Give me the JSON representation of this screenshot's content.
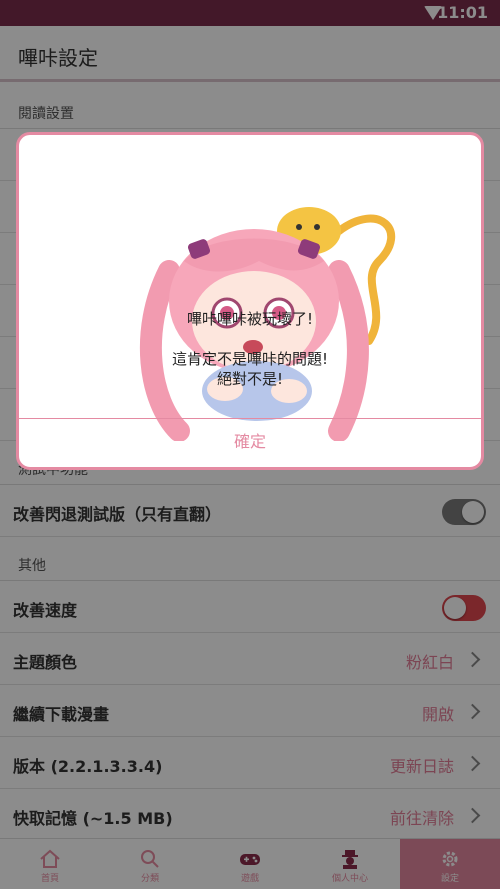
{
  "status": {
    "time": "11:01"
  },
  "appbar": {
    "title": "嗶咔設定"
  },
  "settings": {
    "section_reading": "閱讀設置",
    "section_test": "測試中功能",
    "test_item": "改善閃退測試版（只有直翻）",
    "section_other": "其他",
    "speed": "改善速度",
    "theme_label": "主題顏色",
    "theme_value": "粉紅白",
    "download_label": "繼續下載漫畫",
    "download_value": "開啟",
    "version_label": "版本 (2.2.1.3.3.4)",
    "version_value": "更新日誌",
    "cache_label": "快取記憶 (~1.5 MB)",
    "cache_value": "前往清除"
  },
  "tabs": [
    {
      "label": "首頁",
      "icon": "home-icon"
    },
    {
      "label": "分類",
      "icon": "search-icon"
    },
    {
      "label": "遊戲",
      "icon": "gamepad-icon"
    },
    {
      "label": "個人中心",
      "icon": "profile-icon"
    },
    {
      "label": "設定",
      "icon": "gear-icon"
    }
  ],
  "dialog": {
    "line1": "嗶咔嗶咔被玩壞了!",
    "line2": "這肯定不是嗶咔的問題!",
    "line3": "絕對不是!",
    "confirm": "確定"
  },
  "colors": {
    "primary": "#7b2c4b",
    "accent": "#e48aa2",
    "toggle_on": "#e1474f"
  }
}
